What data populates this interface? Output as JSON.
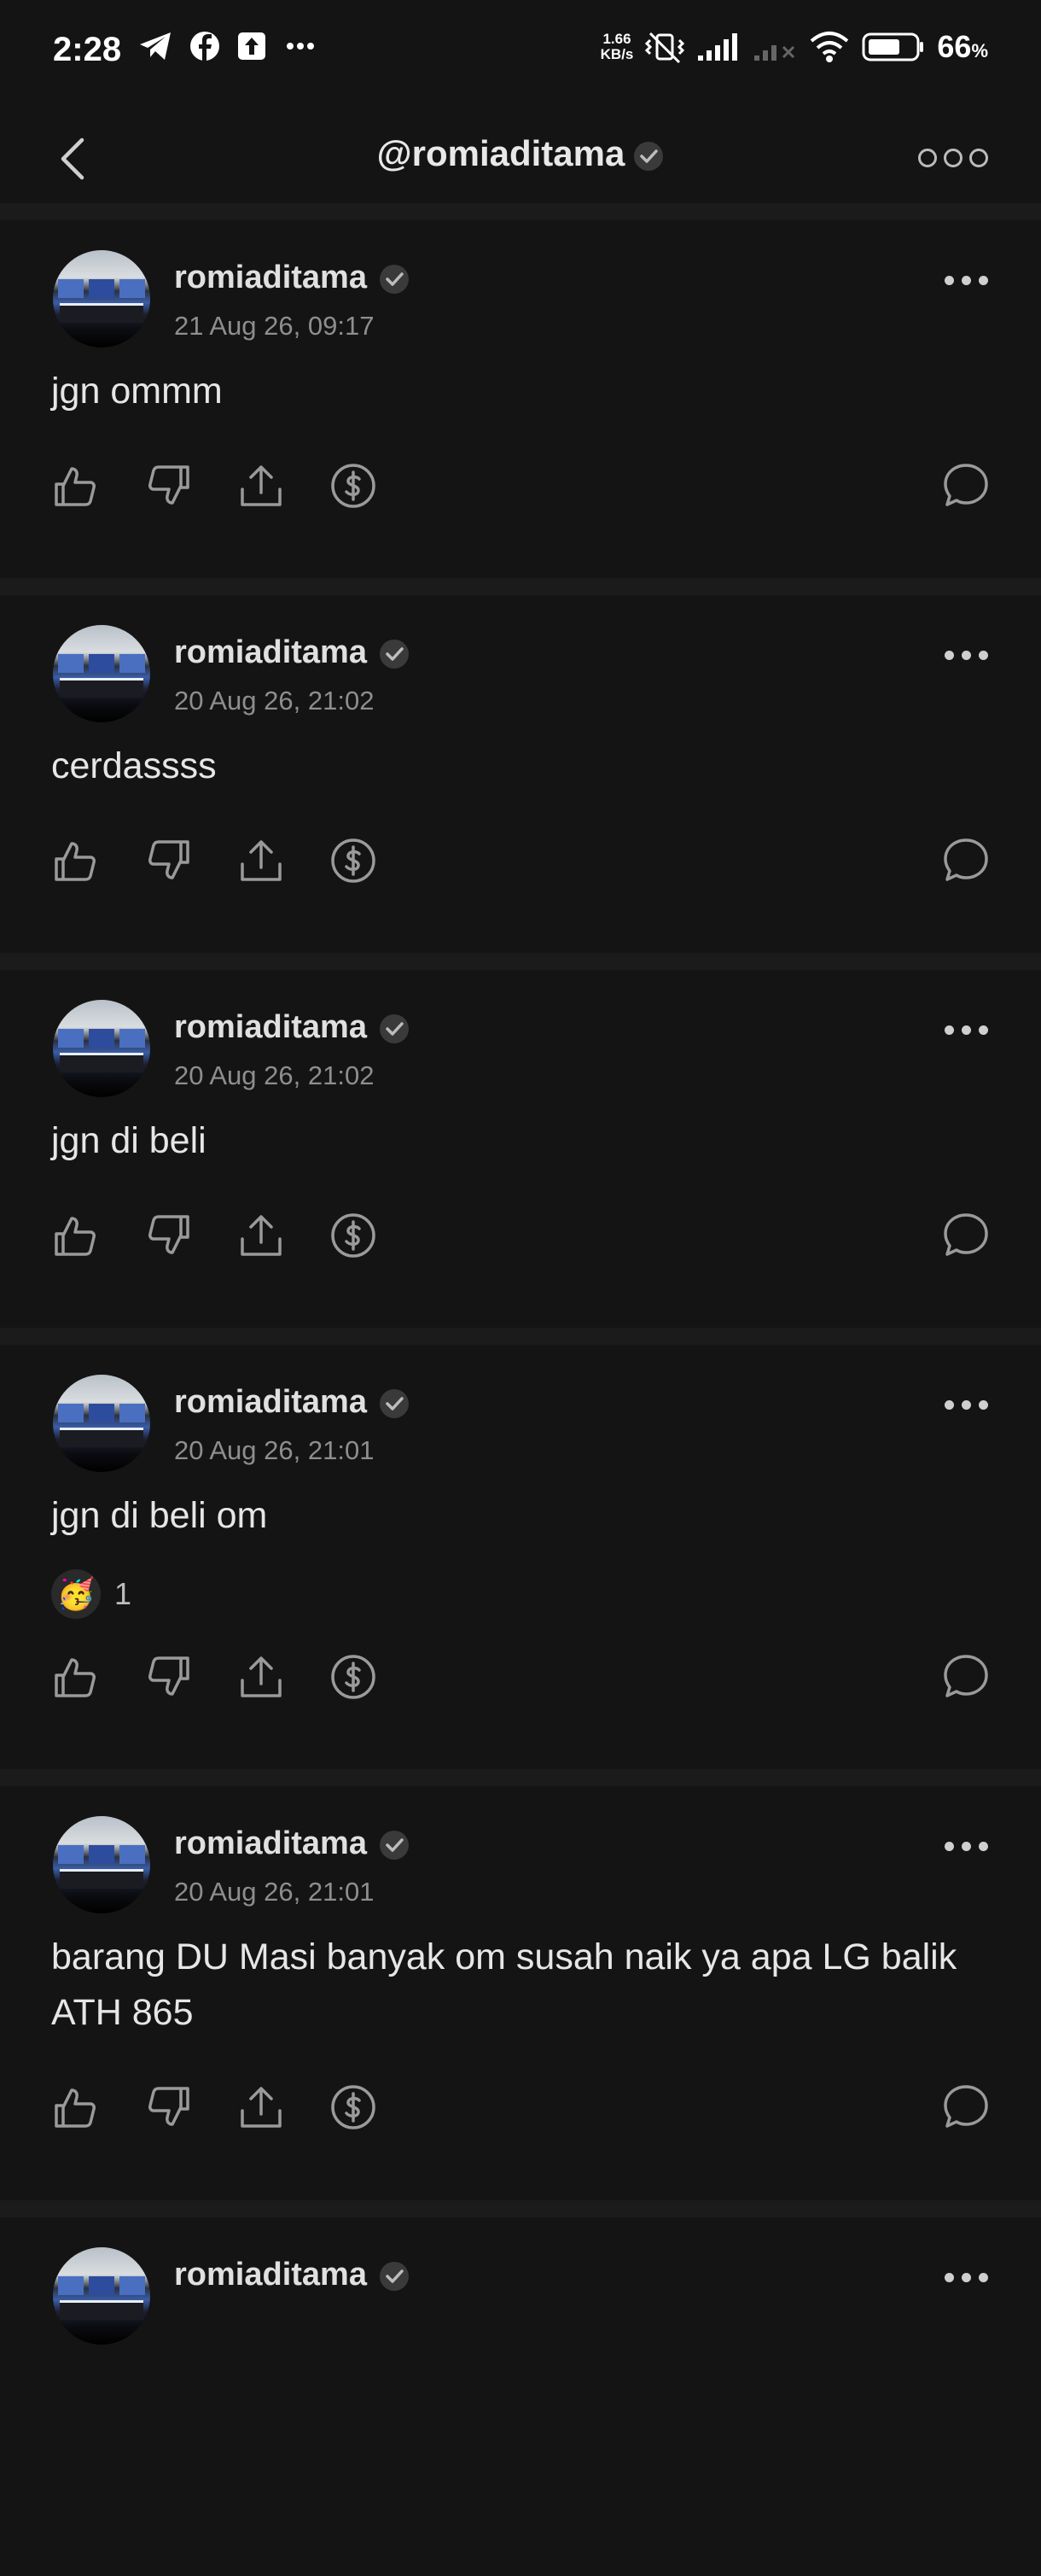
{
  "status_bar": {
    "time": "2:28",
    "net_speed_value": "1.66",
    "net_speed_unit": "KB/s",
    "battery_percent": "66",
    "battery_unit": "%",
    "left_icons": [
      "telegram-icon",
      "facebook-icon",
      "upload-notification-icon",
      "more-notifications-icon"
    ],
    "right_icons": [
      "vibrate-off-icon",
      "signal-icon",
      "signal-no-sim-icon",
      "wifi-icon",
      "battery-icon"
    ]
  },
  "header": {
    "title": "@romiaditama",
    "back_icon": "chevron-left-icon",
    "more_icon": "more-horizontal-icon"
  },
  "posts": [
    {
      "author": "romiaditama",
      "date": "21 Aug 26, 09:17",
      "text": "jgn ommm",
      "reaction": null
    },
    {
      "author": "romiaditama",
      "date": "20 Aug 26, 21:02",
      "text": "cerdassss",
      "reaction": null
    },
    {
      "author": "romiaditama",
      "date": "20 Aug 26, 21:02",
      "text": "jgn di beli",
      "reaction": null
    },
    {
      "author": "romiaditama",
      "date": "20 Aug 26, 21:01",
      "text": "jgn di beli om",
      "reaction": {
        "emoji": "🥳",
        "count": "1"
      }
    },
    {
      "author": "romiaditama",
      "date": "20 Aug 26, 21:01",
      "text": "barang DU Masi banyak om susah naik ya apa LG balik ATH 865",
      "reaction": null
    },
    {
      "author": "romiaditama",
      "date": "",
      "text": "",
      "reaction": null
    }
  ],
  "action_icons": [
    "thumbs-up-icon",
    "thumbs-down-icon",
    "share-icon",
    "tip-dollar-icon",
    "comment-icon"
  ],
  "colors": {
    "background": "#141414",
    "divider": "#1b1b1b",
    "text": "#e6e6e6",
    "muted": "#8e8e8e",
    "verified_badge": "#3a3a3a"
  }
}
